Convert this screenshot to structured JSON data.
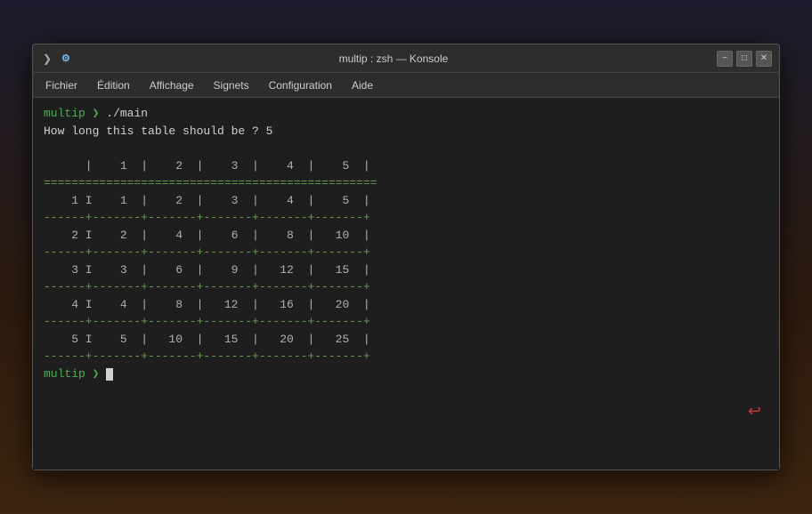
{
  "window": {
    "title": "multip : zsh — Konsole",
    "icon_terminal": "❯",
    "icon_zsh": "⚙"
  },
  "titlebar_buttons": {
    "minimize": "−",
    "maximize": "□",
    "close": "✕"
  },
  "menubar": {
    "items": [
      "Fichier",
      "Édition",
      "Affichage",
      "Signets",
      "Configuration",
      "Aide"
    ]
  },
  "terminal": {
    "prompt1": "multip",
    "cmd": "./main",
    "output_lines": [
      "How long this table should be ? 5",
      "",
      "      |    1  |    2  |    3  |    4  |    5  |",
      "================================================",
      "    1 I    1  |    2  |    3  |    4  |    5  |",
      "------+-------+-------+-------+-------+-------+",
      "    2 I    2  |    4  |    6  |    8  |   10  |",
      "------+-------+-------+-------+-------+-------+",
      "    3 I    3  |    6  |    9  |   12  |   15  |",
      "------+-------+-------+-------+-------+-------+",
      "    4 I    4  |    8  |   12  |   16  |   20  |",
      "------+-------+-------+-------+-------+-------+",
      "    5 I    5  |   10  |   15  |   20  |   25  |",
      "------+-------+-------+-------+-------+-------+"
    ],
    "prompt2": "multip"
  }
}
